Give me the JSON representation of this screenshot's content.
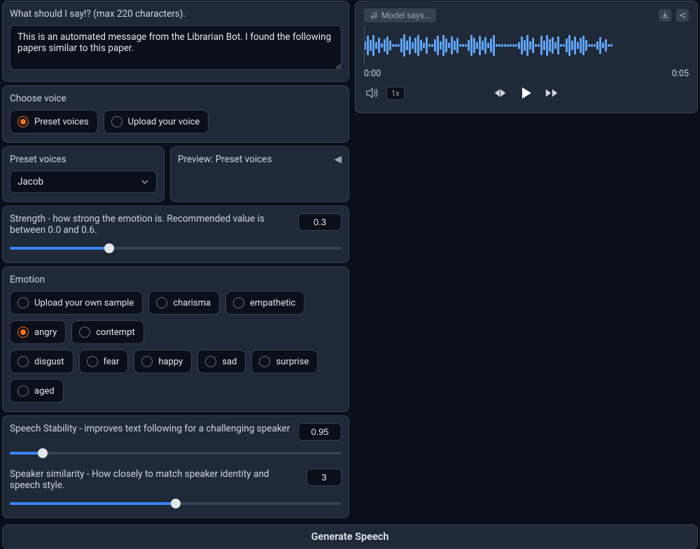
{
  "input": {
    "label": "What should I say!? (max 220 characters).",
    "value": "This is an automated message from the Librarian Bot. I found the following papers similar to this paper."
  },
  "voice_section": {
    "label": "Choose voice",
    "options": {
      "preset": "Preset voices",
      "upload": "Upload your voice"
    },
    "selected": "preset"
  },
  "preset_panel": {
    "label": "Preset voices",
    "selected_value": "Jacob"
  },
  "preview_panel": {
    "label": "Preview: Preset voices"
  },
  "strength": {
    "label": "Strength - how strong the emotion is. Recommended value is between 0.0 and 0.6.",
    "value": "0.3",
    "min": 0.0,
    "max": 1.0
  },
  "emotion": {
    "label": "Emotion",
    "options": {
      "upload": "Upload your own sample",
      "charisma": "charisma",
      "empathetic": "empathetic",
      "angry": "angry",
      "contempt": "contempt",
      "disgust": "disgust",
      "fear": "fear",
      "happy": "happy",
      "sad": "sad",
      "surprise": "surprise",
      "aged": "aged"
    },
    "selected": "angry"
  },
  "stability": {
    "label": "Speech Stability - improves text following for a challenging speaker",
    "value": "0.95",
    "min": 0.0,
    "max": 10.0,
    "fill_pct": 10
  },
  "similarity": {
    "label": "Speaker similarity - How closely to match speaker identity and speech style.",
    "value": "3",
    "min": 0,
    "max": 6,
    "fill_pct": 50
  },
  "generate_label": "Generate Speech",
  "player": {
    "title": "Model says...",
    "time_current": "0:00",
    "time_total": "0:05",
    "speed": "1x"
  },
  "icons": {
    "music": "music-icon",
    "download": "download-icon",
    "share": "share-icon",
    "volume": "volume-icon",
    "back": "skip-back-icon",
    "play": "play-icon",
    "forward": "skip-forward-icon",
    "chevron": "chevron-down-icon",
    "preview_play": "preview-play-icon"
  }
}
